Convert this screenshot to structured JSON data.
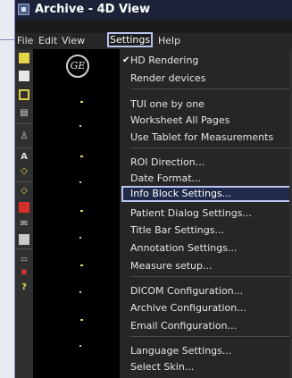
{
  "window": {
    "title": "Archive - 4D View"
  },
  "menubar": {
    "file": "File",
    "edit": "Edit",
    "view": "View",
    "settings": "Settings",
    "help": "Help"
  },
  "logo": {
    "text": "GE"
  },
  "settings_menu": {
    "items": [
      {
        "label": "HD Rendering",
        "checked": true
      },
      {
        "label": "Render devices"
      },
      {
        "label": "TUI one by one"
      },
      {
        "label": "Worksheet All Pages"
      },
      {
        "label": "Use Tablet for Measurements"
      },
      {
        "label": "ROI Direction..."
      },
      {
        "label": "Date Format..."
      },
      {
        "label": "Info Block Settings..."
      },
      {
        "label": "Patient Dialog Settings..."
      },
      {
        "label": "Title Bar Settings..."
      },
      {
        "label": "Annotation Settings..."
      },
      {
        "label": "Measure setup..."
      },
      {
        "label": "DICOM Configuration..."
      },
      {
        "label": "Archive Configuration..."
      },
      {
        "label": "Email Configuration..."
      },
      {
        "label": "Language Settings..."
      },
      {
        "label": "Select Skin..."
      }
    ]
  },
  "toolbar_icons": [
    "folder-icon",
    "page-icon",
    "save-icon",
    "print-icon",
    "person-icon",
    "text-tool-icon",
    "diamond-icon",
    "diamond-outline-icon",
    "tag-icon",
    "envelope-icon",
    "report-icon",
    "delete-icon",
    "help-icon"
  ],
  "colors": {
    "highlight_border": "#b9c3ee",
    "menu_bg": "#262626",
    "title_bg": "#1c2238"
  }
}
